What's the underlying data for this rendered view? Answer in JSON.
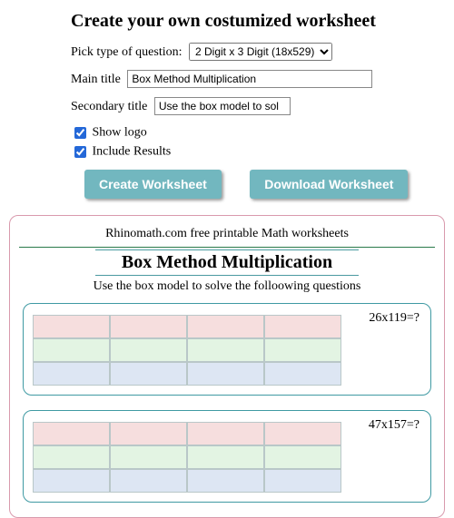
{
  "heading": "Create your own costumized worksheet",
  "form": {
    "pick_label": "Pick type of question:",
    "pick_value": "2 Digit x 3 Digit (18x529)",
    "main_title_label": "Main title",
    "main_title_value": "Box Method Multiplication",
    "secondary_title_label": "Secondary title",
    "secondary_title_value": "Use the box model to sol",
    "show_logo_label": "Show logo",
    "include_results_label": "Include Results"
  },
  "buttons": {
    "create": "Create Worksheet",
    "download": "Download Worksheet"
  },
  "preview": {
    "brand": "Rhinomath.com free printable Math worksheets",
    "title": "Box Method Multiplication",
    "subtitle": "Use the box model to solve the folloowing questions",
    "questions": [
      {
        "prompt": "26x119=?"
      },
      {
        "prompt": "47x157=?"
      }
    ]
  }
}
